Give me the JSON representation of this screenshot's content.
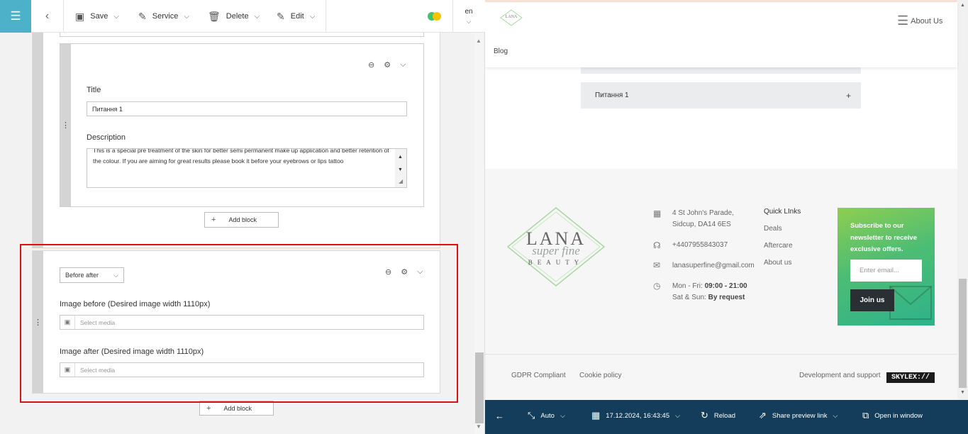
{
  "toolbar": {
    "save": "Save",
    "service": "Service",
    "delete": "Delete",
    "edit": "Edit",
    "lang": "en"
  },
  "editor": {
    "block1": {
      "title_label": "Title",
      "title_value": "Питання 1",
      "description_label": "Description",
      "description_value": "This is a special pre treatment of the skin for better semi permanent make up application and better retention of the colour. If you are aiming for great results please book it before your eyebrows or lips tattoo",
      "add_block": "Add block"
    },
    "block2": {
      "type_select": "Before after",
      "image_before_label": "Image before (Desired image width 1110px)",
      "image_before_placeholder": "Select media",
      "image_after_label": "Image after (Desired image width 1110px)",
      "image_after_placeholder": "Select media",
      "add_block": "Add block"
    }
  },
  "preview": {
    "header": {
      "menu_label": "About Us",
      "blog": "Blog"
    },
    "accordion_item": "Питання 1",
    "footer": {
      "logo": {
        "line1": "LANA",
        "line2": "super fine",
        "line3": "BEAUTY"
      },
      "address": [
        "4 St John's Parade,",
        "Sidcup, DA14 6ES"
      ],
      "phone": "+4407955843037",
      "email": "lanasuperfine@gmail.com",
      "hours1_prefix": "Mon - Fri:",
      "hours1_value": "09:00 - 21:00",
      "hours2_prefix": "Sat & Sun:",
      "hours2_value": "By request",
      "quick_links_title": "Quick LInks",
      "quick_links": [
        "Deals",
        "Aftercare",
        "About us"
      ],
      "subscribe_text": "Subscribe to our newsletter to receive exclusive offers.",
      "email_placeholder": "Enter email...",
      "join_button": "Join us",
      "gdpr": "GDPR Compliant",
      "cookie": "Cookie policy",
      "dev_support": "Development and support",
      "skylex": "SKYLEX://"
    },
    "bottombar": {
      "size": "Auto",
      "datetime": "17.12.2024, 16:43:45",
      "reload": "Reload",
      "share": "Share preview link",
      "open_window": "Open in window"
    }
  },
  "colors": {
    "accent": "#4db2c9",
    "bottom_bar": "#133d5a",
    "highlight": "#dd1111",
    "toggle_green": "#3cc46e",
    "toggle_yellow": "#f5c400"
  }
}
